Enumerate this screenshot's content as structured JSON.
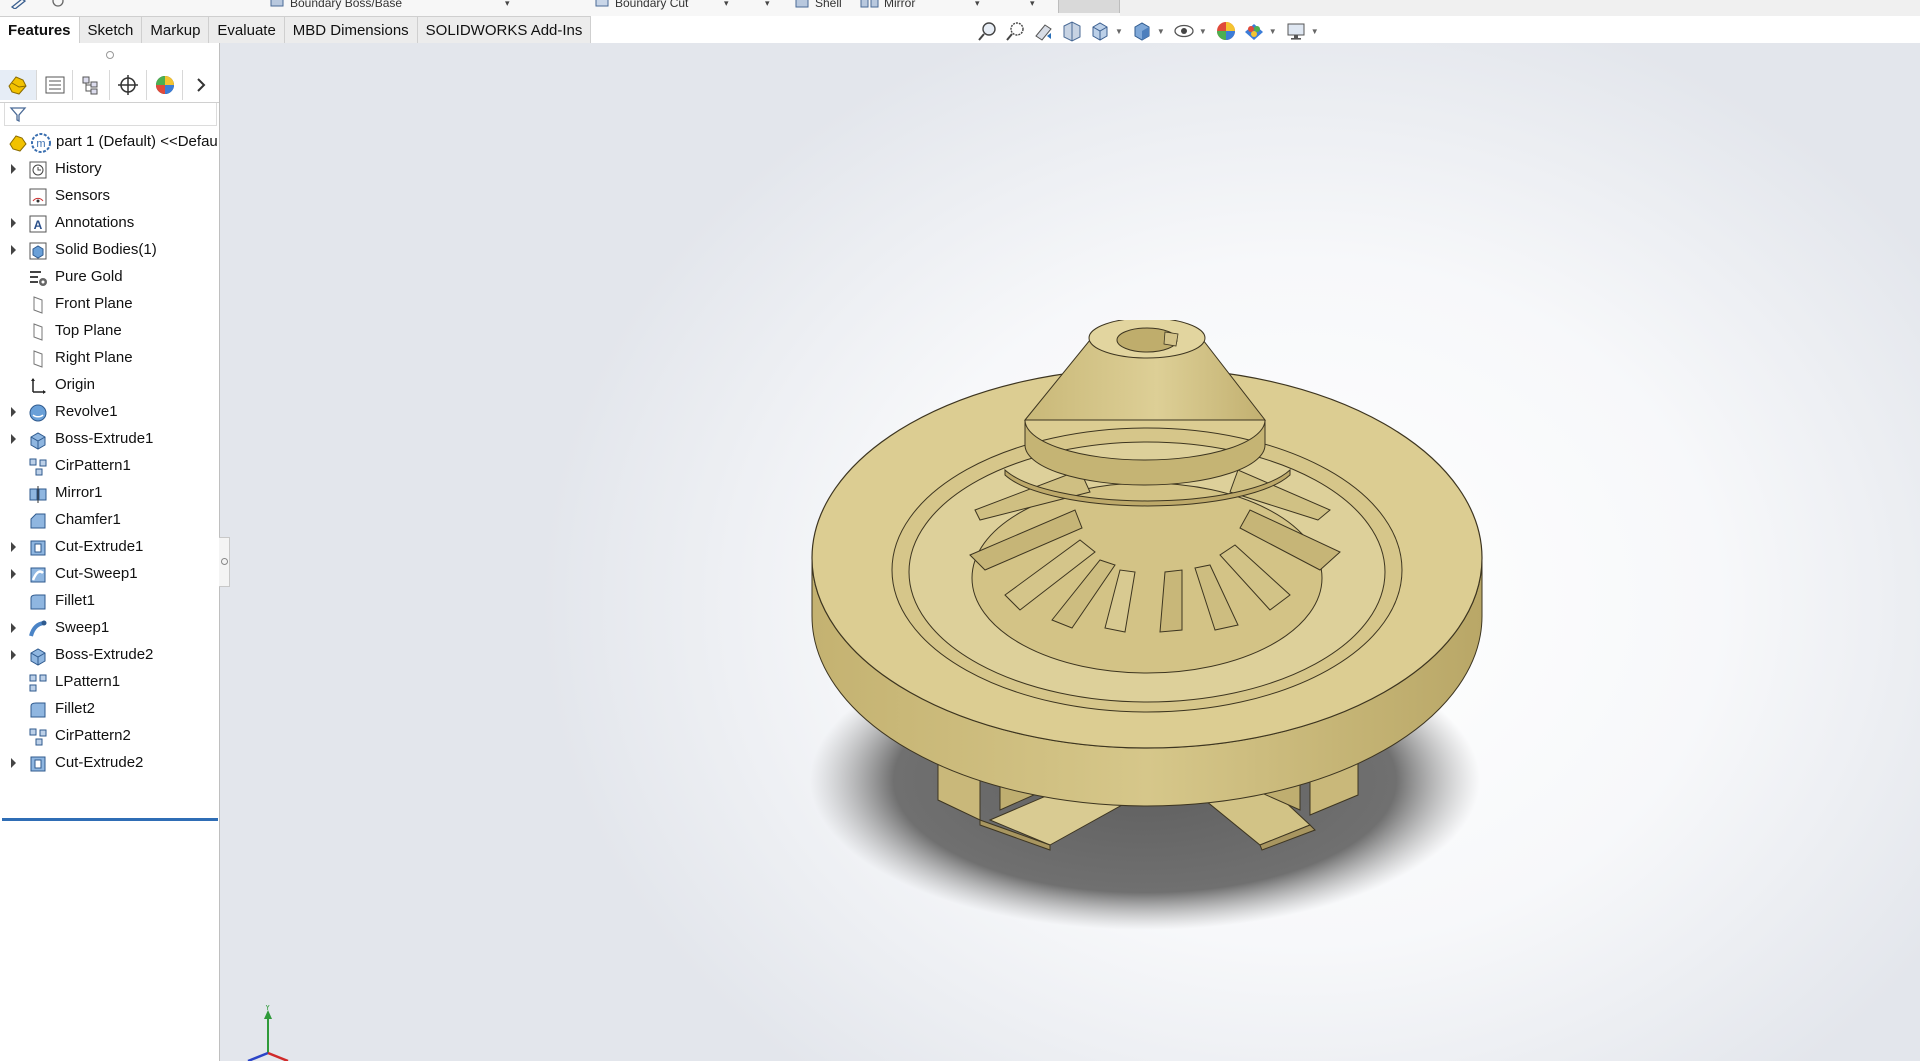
{
  "top_toolbar": {
    "items": [
      {
        "label": "Boundary Boss/Base"
      },
      {
        "label": "Boundary Cut"
      },
      {
        "label": "Shell"
      },
      {
        "label": "Mirror"
      }
    ]
  },
  "command_tabs": [
    {
      "label": "Features",
      "active": true
    },
    {
      "label": "Sketch"
    },
    {
      "label": "Markup"
    },
    {
      "label": "Evaluate"
    },
    {
      "label": "MBD Dimensions"
    },
    {
      "label": "SOLIDWORKS Add-Ins"
    }
  ],
  "heads_up_toolbar": {
    "icons": [
      "zoom-to-fit-icon",
      "zoom-to-area-icon",
      "previous-view-icon",
      "section-view-icon",
      "view-orientation-icon",
      "display-style-icon",
      "hide-show-items-icon",
      "edit-appearance-icon",
      "apply-scene-icon",
      "view-settings-icon"
    ]
  },
  "panel_tabs": [
    {
      "icon": "featuremanager-tree-icon"
    },
    {
      "icon": "propertymanager-icon"
    },
    {
      "icon": "configurationmanager-icon"
    },
    {
      "icon": "dimxpertmanager-icon"
    },
    {
      "icon": "displaymanager-icon"
    },
    {
      "icon": "chevron-right-icon"
    }
  ],
  "feature_tree": {
    "root": {
      "label": "part 1 (Default) <<Defau"
    },
    "items": [
      {
        "label": "History",
        "icon": "history-icon",
        "expandable": true
      },
      {
        "label": "Sensors",
        "icon": "sensors-icon",
        "expandable": false
      },
      {
        "label": "Annotations",
        "icon": "annotations-icon",
        "expandable": true
      },
      {
        "label": "Solid Bodies(1)",
        "icon": "solid-bodies-icon",
        "expandable": true
      },
      {
        "label": "Pure Gold",
        "icon": "material-icon",
        "expandable": false
      },
      {
        "label": "Front Plane",
        "icon": "plane-icon",
        "expandable": false
      },
      {
        "label": "Top Plane",
        "icon": "plane-icon",
        "expandable": false
      },
      {
        "label": "Right Plane",
        "icon": "plane-icon",
        "expandable": false
      },
      {
        "label": "Origin",
        "icon": "origin-icon",
        "expandable": false
      },
      {
        "label": "Revolve1",
        "icon": "revolve-icon",
        "expandable": true
      },
      {
        "label": "Boss-Extrude1",
        "icon": "extrude-icon",
        "expandable": true
      },
      {
        "label": "CirPattern1",
        "icon": "circular-pattern-icon",
        "expandable": false
      },
      {
        "label": "Mirror1",
        "icon": "mirror-icon",
        "expandable": false
      },
      {
        "label": "Chamfer1",
        "icon": "chamfer-icon",
        "expandable": false
      },
      {
        "label": "Cut-Extrude1",
        "icon": "cut-extrude-icon",
        "expandable": true
      },
      {
        "label": "Cut-Sweep1",
        "icon": "cut-sweep-icon",
        "expandable": true
      },
      {
        "label": "Fillet1",
        "icon": "fillet-icon",
        "expandable": false
      },
      {
        "label": "Sweep1",
        "icon": "sweep-icon",
        "expandable": true
      },
      {
        "label": "Boss-Extrude2",
        "icon": "extrude-icon",
        "expandable": true
      },
      {
        "label": "LPattern1",
        "icon": "linear-pattern-icon",
        "expandable": false
      },
      {
        "label": "Fillet2",
        "icon": "fillet-icon",
        "expandable": false
      },
      {
        "label": "CirPattern2",
        "icon": "circular-pattern-icon",
        "expandable": false
      },
      {
        "label": "Cut-Extrude2",
        "icon": "cut-extrude-icon",
        "expandable": true
      }
    ]
  },
  "triad": {
    "y_label": "Y"
  },
  "colors": {
    "model_gold": "#d8c98e",
    "model_gold_dark": "#b9a767",
    "rollback_bar": "#2f6db5",
    "shadow": "#6f6f6f"
  }
}
